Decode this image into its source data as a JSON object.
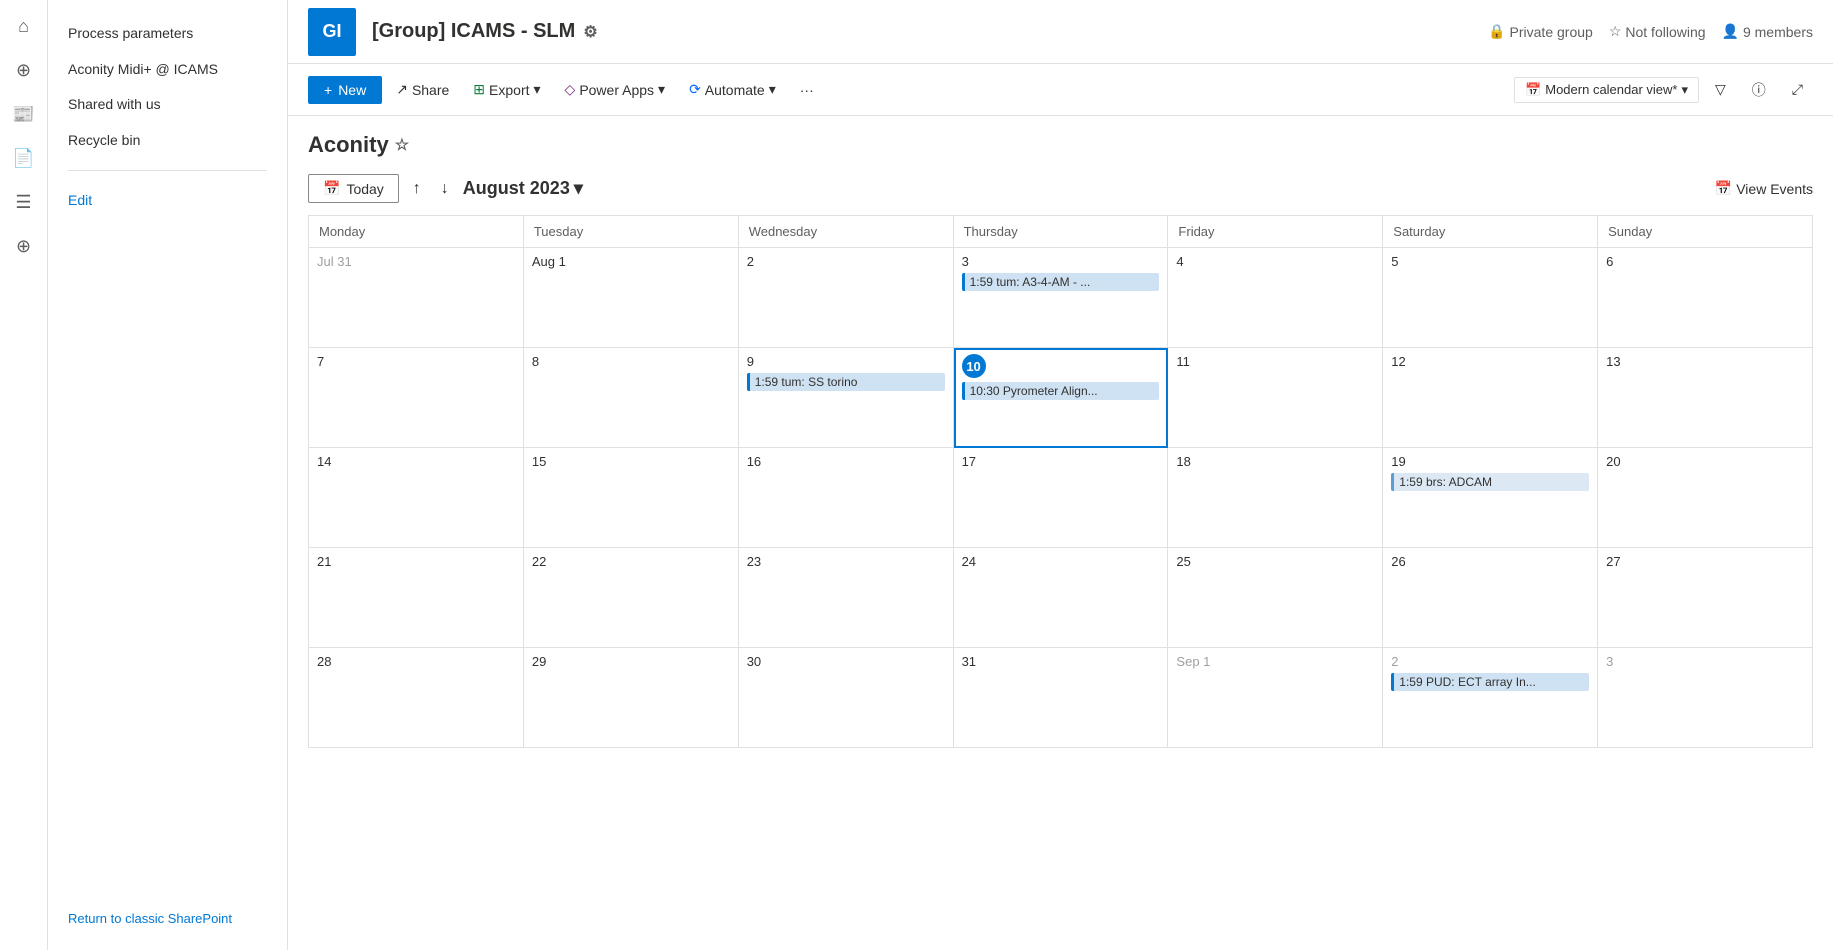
{
  "group": {
    "initials": "GI",
    "title": "[Group] ICAMS - SLM",
    "privacy": "Private group",
    "following": "Not following",
    "members": "9 members"
  },
  "toolbar": {
    "new_label": "+ New",
    "share_label": "Share",
    "export_label": "Export",
    "powerapps_label": "Power Apps",
    "automate_label": "Automate",
    "more_label": "···",
    "view_label": "Modern calendar view*"
  },
  "calendar": {
    "title": "Aconity",
    "today_label": "Today",
    "month": "August 2023",
    "view_events_label": "View Events",
    "days": [
      "Monday",
      "Tuesday",
      "Wednesday",
      "Thursday",
      "Friday",
      "Saturday",
      "Sunday"
    ],
    "weeks": [
      [
        {
          "date": "Jul 31",
          "other": true,
          "events": []
        },
        {
          "date": "Aug 1",
          "events": []
        },
        {
          "date": "2",
          "events": []
        },
        {
          "date": "3",
          "events": [
            {
              "time": "1:59",
              "text": "tum: A3-4-AM - ..."
            }
          ]
        },
        {
          "date": "4",
          "events": []
        },
        {
          "date": "5",
          "events": []
        },
        {
          "date": "6",
          "events": []
        }
      ],
      [
        {
          "date": "7",
          "events": []
        },
        {
          "date": "8",
          "events": []
        },
        {
          "date": "9",
          "events": [
            {
              "time": "1:59",
              "text": "tum: SS torino"
            }
          ]
        },
        {
          "date": "Aug 10",
          "today": true,
          "events": [
            {
              "time": "10:30",
              "text": "Pyrometer Align..."
            }
          ]
        },
        {
          "date": "11",
          "events": []
        },
        {
          "date": "12",
          "events": []
        },
        {
          "date": "13",
          "events": []
        }
      ],
      [
        {
          "date": "14",
          "events": []
        },
        {
          "date": "15",
          "events": []
        },
        {
          "date": "16",
          "events": []
        },
        {
          "date": "17",
          "events": []
        },
        {
          "date": "18",
          "events": []
        },
        {
          "date": "19",
          "events": [
            {
              "time": "1:59",
              "text": "brs: ADCAM",
              "style": "blue-light"
            }
          ]
        },
        {
          "date": "20",
          "events": []
        }
      ],
      [
        {
          "date": "21",
          "events": []
        },
        {
          "date": "22",
          "events": []
        },
        {
          "date": "23",
          "events": []
        },
        {
          "date": "24",
          "events": []
        },
        {
          "date": "25",
          "events": []
        },
        {
          "date": "26",
          "events": []
        },
        {
          "date": "27",
          "events": []
        }
      ],
      [
        {
          "date": "28",
          "events": []
        },
        {
          "date": "29",
          "events": []
        },
        {
          "date": "30",
          "events": []
        },
        {
          "date": "31",
          "events": []
        },
        {
          "date": "Sep 1",
          "other": true,
          "events": []
        },
        {
          "date": "2",
          "other": true,
          "events": [
            {
              "time": "1:59",
              "text": "PUD: ECT array In..."
            }
          ]
        },
        {
          "date": "3",
          "other": true,
          "events": []
        }
      ]
    ]
  },
  "sidebar": {
    "items": [
      {
        "label": "Process parameters",
        "link": false
      },
      {
        "label": "Aconity Midi+ @ ICAMS",
        "link": false
      },
      {
        "label": "Shared with us",
        "link": false
      },
      {
        "label": "Recycle bin",
        "link": false
      },
      {
        "label": "Edit",
        "link": true
      }
    ],
    "classic_link": "Return to classic SharePoint"
  }
}
